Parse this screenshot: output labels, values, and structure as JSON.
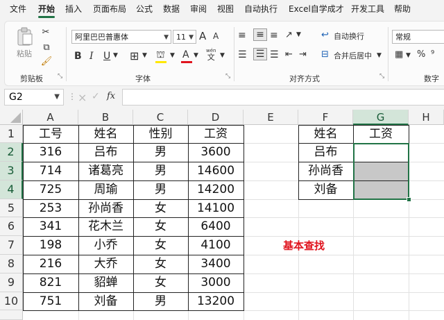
{
  "menu": [
    "文件",
    "开始",
    "插入",
    "页面布局",
    "公式",
    "数据",
    "审阅",
    "视图",
    "自动执行",
    "Excel自学成才",
    "开发工具",
    "帮助"
  ],
  "ribbon": {
    "paste_label": "粘贴",
    "clipboard_label": "剪贴板",
    "font_name": "阿里巴巴普惠体",
    "font_size": "11",
    "font_group_label": "字体",
    "align_group_label": "对齐方式",
    "wrap_label": "自动换行",
    "merge_label": "合并后居中",
    "number_format": "常规",
    "number_group_label": "数字",
    "bold": "B",
    "italic": "I",
    "underline": "U",
    "grow_font": "A",
    "shrink_font": "A",
    "font_color": "A",
    "phonetic_top": "wén",
    "phonetic_bottom": "文"
  },
  "formula_bar": {
    "name_box": "G2",
    "fx": "fx",
    "cancel": "×",
    "confirm": "✓",
    "value": ""
  },
  "columns": [
    "A",
    "B",
    "C",
    "D",
    "E",
    "F",
    "G",
    "H"
  ],
  "rows": [
    "1",
    "2",
    "3",
    "4",
    "5",
    "6",
    "7",
    "8",
    "9",
    "10"
  ],
  "table1": {
    "headers": [
      "工号",
      "姓名",
      "性别",
      "工资"
    ],
    "rows": [
      [
        "316",
        "吕布",
        "男",
        "3600"
      ],
      [
        "714",
        "诸葛亮",
        "男",
        "14600"
      ],
      [
        "725",
        "周瑜",
        "男",
        "14200"
      ],
      [
        "253",
        "孙尚香",
        "女",
        "14100"
      ],
      [
        "341",
        "花木兰",
        "女",
        "6400"
      ],
      [
        "198",
        "小乔",
        "女",
        "4100"
      ],
      [
        "216",
        "大乔",
        "女",
        "3400"
      ],
      [
        "821",
        "貂蝉",
        "女",
        "3000"
      ],
      [
        "751",
        "刘备",
        "男",
        "13200"
      ]
    ]
  },
  "table2": {
    "headers": [
      "姓名",
      "工资"
    ],
    "names": [
      "吕布",
      "孙尚香",
      "刘备"
    ]
  },
  "note": "基本查找",
  "colors": {
    "accent": "#217346",
    "note": "#e0141e",
    "lookup_fill": "#c8c8c8"
  }
}
